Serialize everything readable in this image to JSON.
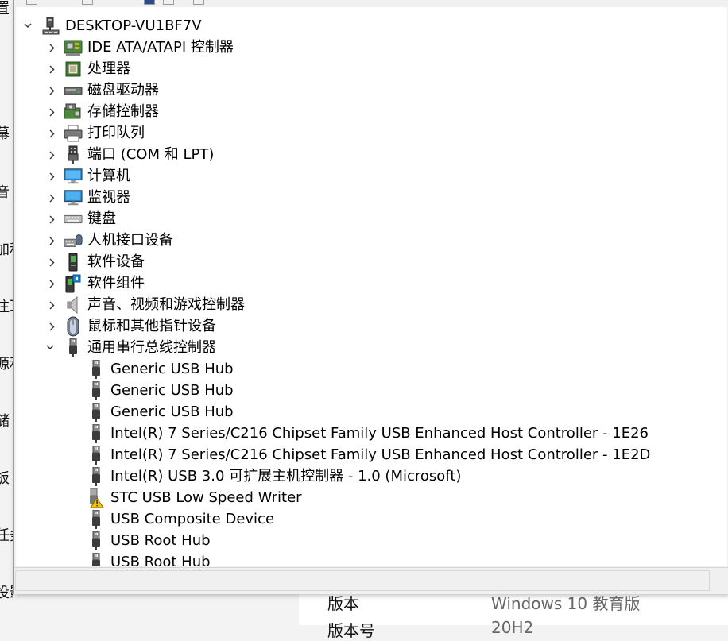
{
  "background_window": {
    "left_fragments": [
      "置",
      "幕",
      "音",
      "加和",
      "注耳",
      "源和",
      "储",
      "板",
      "任务",
      "投影此电脑"
    ],
    "info_rows": [
      {
        "key": "版本",
        "value": "Windows 10 教育版"
      },
      {
        "key": "版本号",
        "value": "20H2"
      }
    ]
  },
  "device_manager": {
    "root": {
      "label": "DESKTOP-VU1BF7V",
      "icon": "computer-network-icon",
      "expanded": true
    },
    "categories": [
      {
        "label": "IDE ATA/ATAPI 控制器",
        "icon": "ide-controller-icon"
      },
      {
        "label": "处理器",
        "icon": "processor-icon"
      },
      {
        "label": "磁盘驱动器",
        "icon": "disk-drive-icon"
      },
      {
        "label": "存储控制器",
        "icon": "storage-controller-icon"
      },
      {
        "label": "打印队列",
        "icon": "printer-icon"
      },
      {
        "label": "端口 (COM 和 LPT)",
        "icon": "port-icon"
      },
      {
        "label": "计算机",
        "icon": "computer-icon"
      },
      {
        "label": "监视器",
        "icon": "monitor-icon"
      },
      {
        "label": "键盘",
        "icon": "keyboard-icon"
      },
      {
        "label": "人机接口设备",
        "icon": "hid-icon"
      },
      {
        "label": "软件设备",
        "icon": "software-device-icon"
      },
      {
        "label": "软件组件",
        "icon": "software-component-icon"
      },
      {
        "label": "声音、视频和游戏控制器",
        "icon": "speaker-icon"
      },
      {
        "label": "鼠标和其他指针设备",
        "icon": "mouse-icon"
      }
    ],
    "usb_category": {
      "label": "通用串行总线控制器",
      "icon": "usb-icon",
      "expanded": true
    },
    "usb_devices": [
      {
        "label": "Generic USB Hub",
        "icon": "usb-plug-icon"
      },
      {
        "label": "Generic USB Hub",
        "icon": "usb-plug-icon"
      },
      {
        "label": "Generic USB Hub",
        "icon": "usb-plug-icon"
      },
      {
        "label": "Intel(R) 7 Series/C216 Chipset Family USB Enhanced Host Controller - 1E26",
        "icon": "usb-plug-icon"
      },
      {
        "label": "Intel(R) 7 Series/C216 Chipset Family USB Enhanced Host Controller - 1E2D",
        "icon": "usb-plug-icon"
      },
      {
        "label": "Intel(R) USB 3.0 可扩展主机控制器 - 1.0 (Microsoft)",
        "icon": "usb-plug-icon"
      },
      {
        "label": "STC USB Low Speed Writer",
        "icon": "usb-warning-icon",
        "warning": true
      },
      {
        "label": "USB Composite Device",
        "icon": "usb-plug-icon"
      },
      {
        "label": "USB Root Hub",
        "icon": "usb-plug-icon"
      },
      {
        "label": "USB Root Hub",
        "icon": "usb-plug-icon"
      }
    ],
    "colors": {
      "tree_bg": "#ffffff",
      "chrome": "#f0f0f0",
      "warning": "#f5c400"
    }
  }
}
